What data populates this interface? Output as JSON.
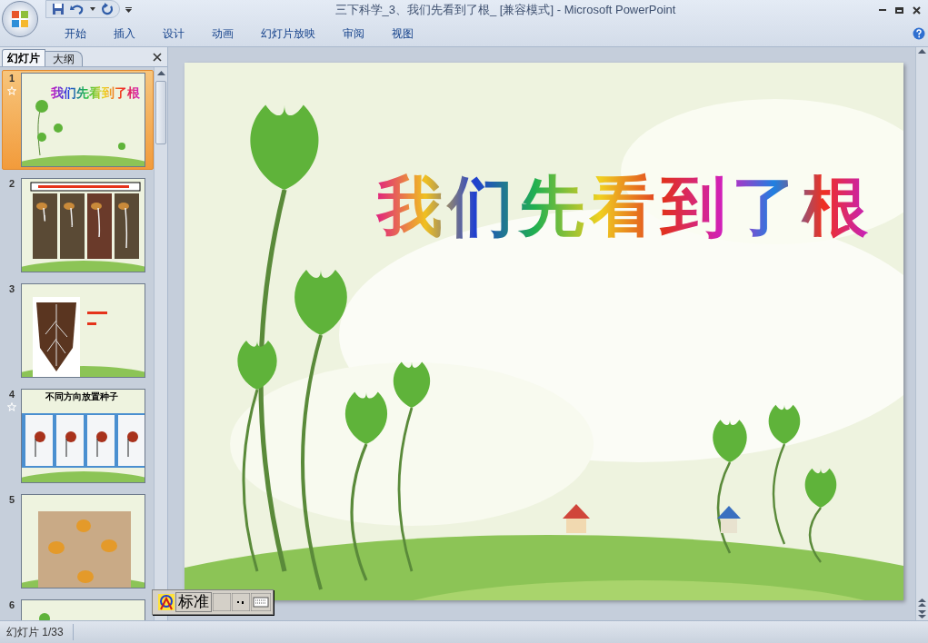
{
  "window": {
    "title": "三下科学_3、我们先看到了根_ [兼容模式] - Microsoft PowerPoint"
  },
  "ribbon_tabs": [
    {
      "label": "开始",
      "selected": false
    },
    {
      "label": "插入",
      "selected": false
    },
    {
      "label": "设计",
      "selected": false
    },
    {
      "label": "动画",
      "selected": false
    },
    {
      "label": "幻灯片放映",
      "selected": false
    },
    {
      "label": "审阅",
      "selected": false
    },
    {
      "label": "视图",
      "selected": false
    }
  ],
  "panel_tabs": [
    {
      "label": "幻灯片",
      "selected": true
    },
    {
      "label": "大纲",
      "selected": false
    }
  ],
  "slides": [
    {
      "number": "1",
      "selected": true,
      "animated": true,
      "kind": "title",
      "title": "我们先看到了根"
    },
    {
      "number": "2",
      "selected": false,
      "animated": false,
      "kind": "seedlings"
    },
    {
      "number": "3",
      "selected": false,
      "animated": false,
      "kind": "roots"
    },
    {
      "number": "4",
      "selected": false,
      "animated": true,
      "kind": "cups",
      "title": "不同方向放置种子"
    },
    {
      "number": "5",
      "selected": false,
      "animated": false
    },
    {
      "number": "6",
      "selected": false,
      "animated": false,
      "kind": "blank"
    }
  ],
  "slide": {
    "title": "我们先看到了根"
  },
  "ime_toolbar": {
    "mode": "标准"
  },
  "status_bar": {
    "text": "幻灯片 1/33"
  }
}
